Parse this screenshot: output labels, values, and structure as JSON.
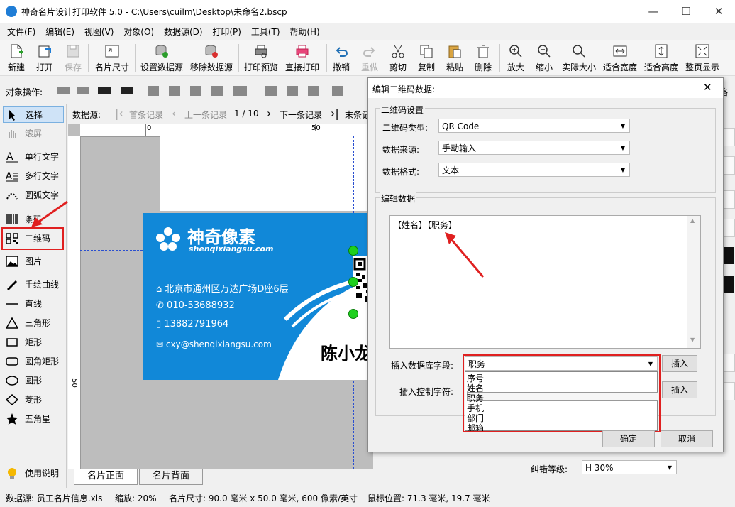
{
  "window": {
    "title": "神奇名片设计打印软件 5.0 - C:\\Users\\cuilm\\Desktop\\未命名2.bscp",
    "min": "—",
    "max": "☐",
    "close": "✕"
  },
  "menu": [
    "文件(F)",
    "编辑(E)",
    "视图(V)",
    "对象(O)",
    "数据源(D)",
    "打印(P)",
    "工具(T)",
    "帮助(H)"
  ],
  "toolbar": {
    "new": "新建",
    "open": "打开",
    "save": "保存",
    "card_size": "名片尺寸",
    "set_ds": "设置数据源",
    "remove_ds": "移除数据源",
    "print_preview": "打印预览",
    "direct_print": "直接打印",
    "undo": "撤销",
    "redo": "重做",
    "cut": "剪切",
    "copy": "复制",
    "paste": "粘贴",
    "delete": "删除",
    "zoom_in": "放大",
    "zoom_out": "缩小",
    "actual": "实际大小",
    "fit_width": "适合宽度",
    "fit_height": "适合高度",
    "fit_page": "整页显示"
  },
  "objrow": {
    "label": "对象操作:",
    "right": "格"
  },
  "tools": [
    "选择",
    "滚屏",
    "单行文字",
    "多行文字",
    "圆弧文字",
    "条码",
    "二维码",
    "图片",
    "手绘曲线",
    "直线",
    "三角形",
    "矩形",
    "圆角矩形",
    "圆形",
    "菱形",
    "五角星",
    "使用说明"
  ],
  "nav": {
    "label": "数据源:",
    "first": "首条记录",
    "prev": "上一条记录",
    "page": "1 / 10",
    "next": "下一条记录",
    "last": "末条记"
  },
  "ruler": {
    "h0": "0",
    "h50": "50",
    "v50": "50"
  },
  "card": {
    "brand": "神奇像素",
    "site": "shenqixiangsu.com",
    "address": "北京市通州区万达广场D座6层",
    "phone": "010-53688932",
    "mobile": "13882791964",
    "email": "cxy@shenqixiangsu.com",
    "name": "陈小龙"
  },
  "tabs": {
    "front": "名片正面",
    "back": "名片背面"
  },
  "status": {
    "ds": "数据源: 员工名片信息.xls",
    "zoom": "缩放: 20%",
    "size": "名片尺寸: 90.0 毫米 x 50.0 毫米, 600 像素/英寸",
    "mouse": "鼠标位置: 71.3 毫米, 19.7 毫米"
  },
  "dialog": {
    "title": "编辑二维码数据:",
    "settings_group": "二维码设置",
    "type_label": "二维码类型:",
    "type_value": "QR Code",
    "source_label": "数据来源:",
    "source_value": "手动输入",
    "format_label": "数据格式:",
    "format_value": "文本",
    "edit_group": "编辑数据",
    "text": "【姓名】【职务】",
    "insert_field_label": "插入数据库字段:",
    "insert_field_value": "职务",
    "field_options": [
      "序号",
      "姓名",
      "职务",
      "手机",
      "部门",
      "邮箱"
    ],
    "insert_ctrl_label": "插入控制字符:",
    "insert": "插入",
    "ok": "确定",
    "cancel": "取消"
  },
  "rightpanel": {
    "ecc_label": "纠错等级:",
    "ecc_value": "H 30%"
  },
  "colors": {
    "accent": "#1188d8",
    "highlight": "#e02020",
    "selection": "#0078d7"
  }
}
